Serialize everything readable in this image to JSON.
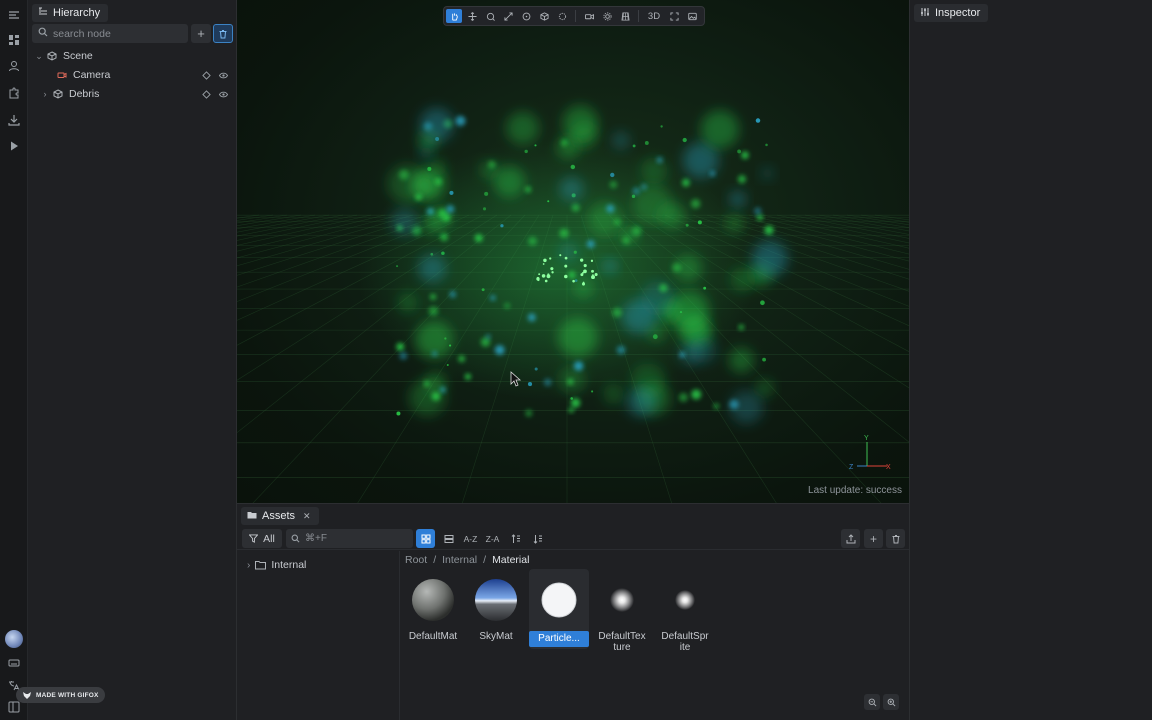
{
  "hierarchy": {
    "tab_label": "Hierarchy",
    "search_placeholder": "search node",
    "nodes": [
      {
        "label": "Scene"
      },
      {
        "label": "Camera"
      },
      {
        "label": "Debris"
      }
    ]
  },
  "viewport": {
    "mode_label": "3D",
    "status": "Last update: success",
    "axes": {
      "x": "X",
      "y": "Y",
      "z": "Z"
    }
  },
  "inspector": {
    "tab_label": "Inspector"
  },
  "assets": {
    "tab_label": "Assets",
    "close_glyph": "✕",
    "filter_label": "All",
    "search_placeholder": "⌘+F",
    "sort_az": "A-Z",
    "sort_za": "Z-A",
    "folders": [
      {
        "label": "Internal"
      }
    ],
    "breadcrumb": {
      "root": "Root",
      "mid": "Internal",
      "current": "Material",
      "sep": "/"
    },
    "items": [
      {
        "label": "DefaultMat"
      },
      {
        "label": "SkyMat"
      },
      {
        "label": "Particle..."
      },
      {
        "label": "DefaultTex ture"
      },
      {
        "label": "DefaultSpr ite"
      }
    ]
  },
  "badge": {
    "text": "MADE WITH GIFOX"
  },
  "colors": {
    "accent": "#2f7fd8",
    "particle_green": "#2bd14a",
    "particle_cyan": "#2aa6c8"
  }
}
